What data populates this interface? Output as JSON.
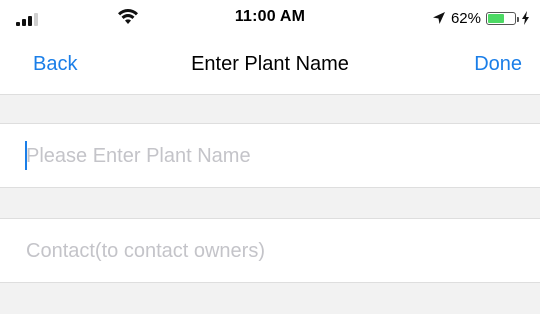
{
  "status_bar": {
    "time": "11:00 AM",
    "battery_percent": "62%",
    "battery_level": 0.62,
    "battery_color": "#4cd964",
    "icons": [
      "signal-icon",
      "wifi-icon",
      "location-arrow-icon",
      "battery-icon",
      "charging-bolt-icon"
    ]
  },
  "nav": {
    "back_label": "Back",
    "title": "Enter Plant Name",
    "done_label": "Done",
    "accent_color": "#1a7ee8"
  },
  "form": {
    "plant_name": {
      "value": "",
      "placeholder": "Please Enter Plant Name"
    },
    "contact": {
      "value": "",
      "placeholder": "Contact(to contact owners)"
    }
  }
}
